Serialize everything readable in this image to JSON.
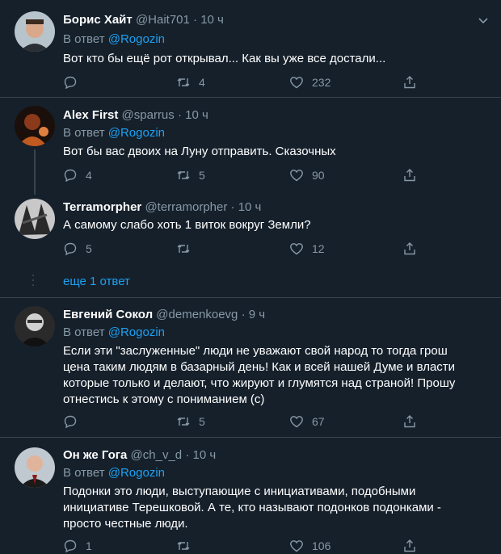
{
  "tweets": [
    {
      "name": "Борис Хайт",
      "handle": "@Hait701",
      "time": "· 10 ч",
      "reply_prefix": "В ответ",
      "reply_to": "@Rogozin",
      "text": "Вот кто бы ещё рот открывал... Как вы уже все достали...",
      "replies": "",
      "retweets": "4",
      "likes": "232"
    },
    {
      "name": "Alex First",
      "handle": "@sparrus",
      "time": "· 10 ч",
      "reply_prefix": "В ответ",
      "reply_to": "@Rogozin",
      "text": "Вот бы вас двоих на Луну отправить. Сказочных",
      "replies": "4",
      "retweets": "5",
      "likes": "90"
    },
    {
      "name": "Terramorpher",
      "handle": "@terramorpher",
      "time": "· 10 ч",
      "text": "А самому слабо хоть 1 виток вокруг Земли?",
      "replies": "5",
      "retweets": "",
      "likes": "12"
    },
    {
      "name": "Евгений Сокол",
      "handle": "@demenkoevg",
      "time": "· 9 ч",
      "reply_prefix": "В ответ",
      "reply_to": "@Rogozin",
      "text": "Если эти \"заслуженные\" люди не уважают свой народ то тогда грош цена таким людям в базарный день! Как и всей нашей Думе и власти которые только и делают, что жируют и глумятся над страной! Прошу отнестись к этому с пониманием (с)",
      "replies": "",
      "retweets": "5",
      "likes": "67"
    },
    {
      "name": "Он же Гога",
      "handle": "@ch_v_d",
      "time": "· 10 ч",
      "reply_prefix": "В ответ",
      "reply_to": "@Rogozin",
      "text": "Подонки это люди, выступающие с инициативами, подобными инициативе Терешковой. А те, кто называют подонков подонками - просто честные люди.",
      "replies": "1",
      "retweets": "",
      "likes": "106"
    }
  ],
  "show_more": "еще 1 ответ",
  "colors": {
    "background": "#15202b",
    "secondary_text": "#8899a6",
    "link": "#1da1f2",
    "separator": "#38444d"
  },
  "icons": {
    "reply": "comment-bubble-icon",
    "retweet": "retweet-icon",
    "like": "heart-icon",
    "share": "share-icon",
    "menu": "chevron-down-icon"
  }
}
